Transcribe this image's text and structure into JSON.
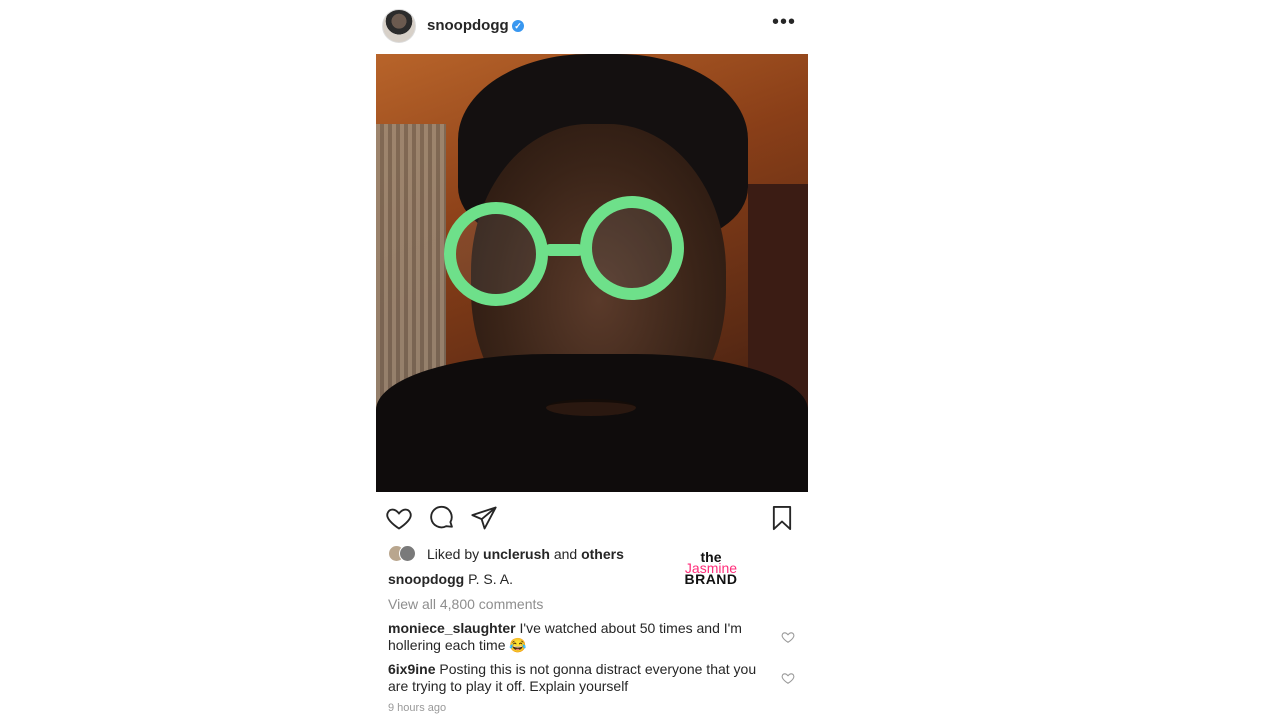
{
  "post": {
    "username": "snoopdogg",
    "verified_mark": "✓",
    "more_icon": "•••",
    "likes": {
      "prefix": "Liked by",
      "user": "unclerush",
      "and": "and",
      "others": "others"
    },
    "caption": {
      "user": "snoopdogg",
      "text": "P. S. A."
    },
    "view_all_comments": "View all 4,800 comments",
    "comments": [
      {
        "user": "moniece_slaughter",
        "text": "I've watched about 50 times and I'm hollering each time 😂"
      },
      {
        "user": "6ix9ine",
        "text": "Posting this is not gonna distract everyone that you are trying to play it off. Explain yourself"
      }
    ],
    "timestamp": "9 hours ago"
  },
  "watermark": {
    "the": "the",
    "jasmine": "Jasmine",
    "brand": "BRAND"
  },
  "colors": {
    "verified": "#3897f0",
    "glasses": "#6ee08a",
    "watermark_accent": "#ff2d7a"
  },
  "icons": [
    "heart-icon",
    "comment-icon",
    "share-icon",
    "bookmark-icon",
    "more-icon"
  ]
}
